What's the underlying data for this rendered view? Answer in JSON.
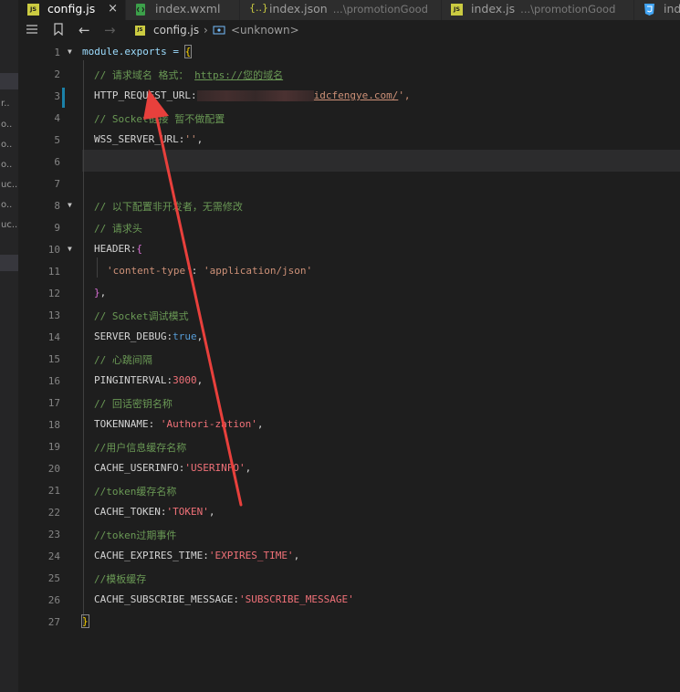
{
  "left_fragments": [
    "r..",
    "o..",
    "o..",
    "o..",
    "uc..",
    "o..",
    "uc.."
  ],
  "tabs": [
    {
      "label": "config.js",
      "desc": "",
      "icon": "js-icon",
      "active": true
    },
    {
      "label": "index.wxml",
      "desc": "",
      "icon": "wxml-icon",
      "active": false
    },
    {
      "label": "index.json",
      "desc": "...\\promotionGood",
      "icon": "json-icon",
      "active": false
    },
    {
      "label": "index.js",
      "desc": "...\\promotionGood",
      "icon": "js-icon",
      "active": false
    },
    {
      "label": "inde",
      "desc": "",
      "icon": "css-icon",
      "active": false
    }
  ],
  "close_glyph": "×",
  "breadcrumb": {
    "file": "config.js",
    "separator": "›",
    "symbol": "<unknown>"
  },
  "code": {
    "l1_a": "module.exports = ",
    "l1_brace": "{",
    "l2_comment": "// 请求域名 格式：",
    "l2_url": "https://您的域名",
    "l3_key": "HTTP_REQUEST_URL:",
    "l3_url": "idcfengye.com/",
    "l3_end": "',",
    "l4_comment": "// Socket链接 暂不做配置",
    "l5_key": "WSS_SERVER_URL:",
    "l5_val": "''",
    "l5_end": ",",
    "l8_comment": "// 以下配置非开发者，无需修改",
    "l9_comment": "// 请求头",
    "l10_key": "HEADER:",
    "l10_brace": "{",
    "l11_key": "'content-type'",
    "l11_sep": ": ",
    "l11_val": "'application/json'",
    "l12_brace": "}",
    "l12_end": ",",
    "l13_comment": "// Socket调试模式",
    "l14_key": "SERVER_DEBUG:",
    "l14_val": "true",
    "l14_end": ",",
    "l15_comment": "// 心跳间隔",
    "l16_key": "PINGINTERVAL:",
    "l16_val": "3000",
    "l16_end": ",",
    "l17_comment": "// 回话密钥名称",
    "l18_key": "TOKENNAME: ",
    "l18_val": "'Authori-zation'",
    "l18_end": ",",
    "l19_comment": "//用户信息缓存名称",
    "l20_key": "CACHE_USERINFO:",
    "l20_val": "'USERINFO'",
    "l20_end": ",",
    "l21_comment": "//token缓存名称",
    "l22_key": "CACHE_TOKEN:",
    "l22_val": "'TOKEN'",
    "l22_end": ",",
    "l23_comment": "//token过期事件",
    "l24_key": "CACHE_EXPIRES_TIME:",
    "l24_val": "'EXPIRES_TIME'",
    "l24_end": ",",
    "l25_comment": "//模板缓存",
    "l26_key": "CACHE_SUBSCRIBE_MESSAGE:",
    "l26_val": "'SUBSCRIBE_MESSAGE'",
    "l27_brace": "}"
  },
  "line_numbers": [
    "1",
    "2",
    "3",
    "4",
    "5",
    "6",
    "7",
    "8",
    "9",
    "10",
    "11",
    "12",
    "13",
    "14",
    "15",
    "16",
    "17",
    "18",
    "19",
    "20",
    "21",
    "22",
    "23",
    "24",
    "25",
    "26",
    "27"
  ],
  "colors": {
    "arrow": "#e8403c",
    "editor_bg": "#1e1e1e"
  }
}
